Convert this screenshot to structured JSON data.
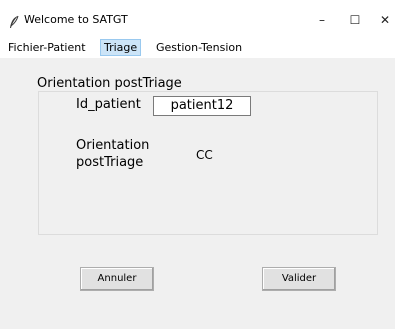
{
  "window": {
    "title": "Welcome to SATGT",
    "icon": "feather-icon",
    "controls": {
      "minimize": "–",
      "maximize": "☐",
      "close": "✕"
    }
  },
  "menu": {
    "items": [
      "Fichier-Patient",
      "Triage",
      "Gestion-Tension"
    ],
    "active": "Triage"
  },
  "form": {
    "group_title": "Orientation postTriage",
    "id_label": "Id_patient",
    "id_value": "patient12",
    "orientation_label": "Orientation postTriage",
    "orientation_value": "CC"
  },
  "buttons": {
    "cancel": "Annuler",
    "submit": "Valider"
  }
}
